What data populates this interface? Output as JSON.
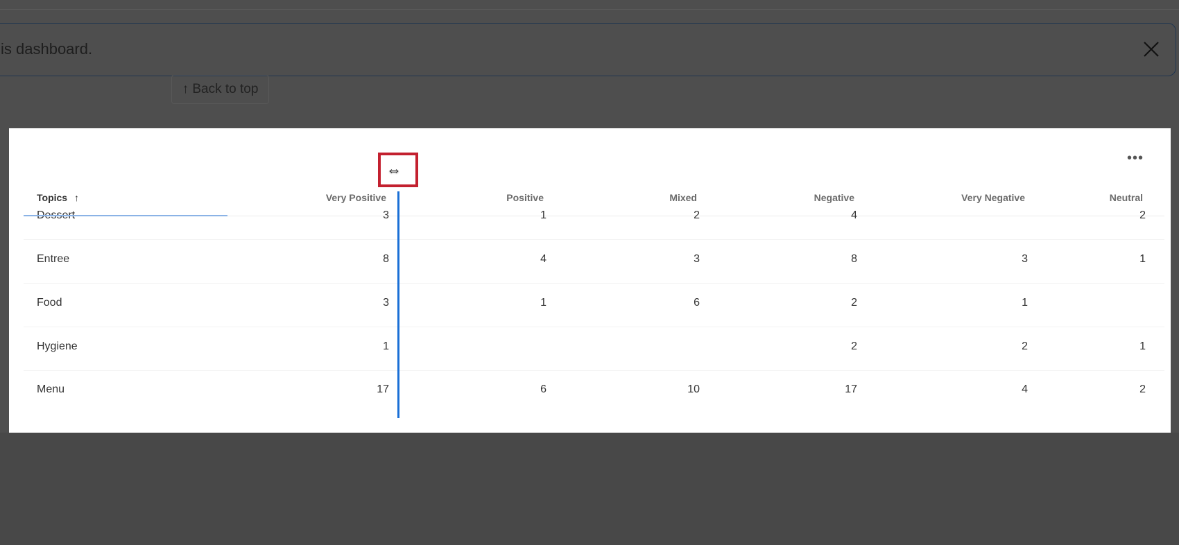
{
  "banner": {
    "text": "is dashboard.",
    "close_icon": "close-icon"
  },
  "back_to_top": "↑ Back to top",
  "widget": {
    "more_icon": "•••",
    "sort_arrow": "↑",
    "cursor_icon": "⇔",
    "columns": [
      "Topics",
      "Very Positive",
      "Positive",
      "Mixed",
      "Negative",
      "Very Negative",
      "Neutral"
    ],
    "rows": [
      {
        "topic": "Dessert",
        "values": [
          "3",
          "1",
          "2",
          "4",
          "",
          "2"
        ]
      },
      {
        "topic": "Entree",
        "values": [
          "8",
          "4",
          "3",
          "8",
          "3",
          "1"
        ]
      },
      {
        "topic": "Food",
        "values": [
          "3",
          "1",
          "6",
          "2",
          "1",
          ""
        ]
      },
      {
        "topic": "Hygiene",
        "values": [
          "1",
          "",
          "",
          "2",
          "2",
          "1"
        ]
      },
      {
        "topic": "Menu",
        "values": [
          "17",
          "6",
          "10",
          "17",
          "4",
          "2"
        ]
      }
    ]
  }
}
